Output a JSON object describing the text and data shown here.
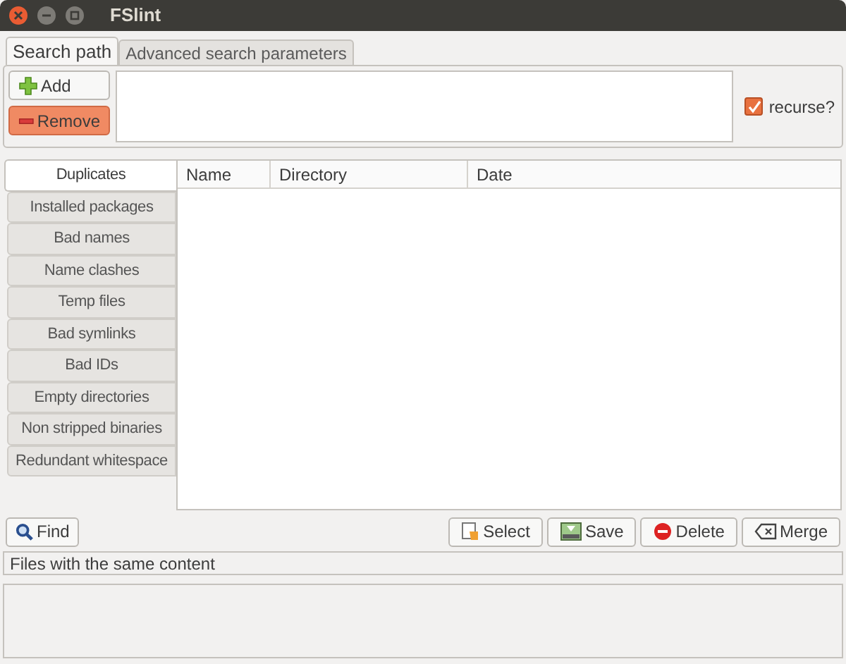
{
  "window": {
    "title": "FSlint"
  },
  "tabs": [
    {
      "label": "Search path",
      "selected": true
    },
    {
      "label": "Advanced search parameters",
      "selected": false
    }
  ],
  "path_buttons": [
    {
      "kind": "add",
      "label": "Add"
    },
    {
      "kind": "remove",
      "label": "Remove"
    }
  ],
  "recurse": {
    "label": "recurse?",
    "checked": true
  },
  "side_tabs": [
    {
      "label": "Duplicates",
      "selected": true
    },
    {
      "label": "Installed packages",
      "selected": false
    },
    {
      "label": "Bad names",
      "selected": false
    },
    {
      "label": "Name clashes",
      "selected": false
    },
    {
      "label": "Temp files",
      "selected": false
    },
    {
      "label": "Bad symlinks",
      "selected": false
    },
    {
      "label": "Bad IDs",
      "selected": false
    },
    {
      "label": "Empty directories",
      "selected": false
    },
    {
      "label": "Non stripped binaries",
      "selected": false
    },
    {
      "label": "Redundant whitespace",
      "selected": false
    }
  ],
  "table": {
    "columns": [
      "Name",
      "Directory",
      "Date"
    ]
  },
  "find_button": "Find",
  "action_buttons": [
    {
      "kind": "select",
      "label": "Select"
    },
    {
      "kind": "save",
      "label": "Save"
    },
    {
      "kind": "delete",
      "label": "Delete"
    },
    {
      "kind": "merge",
      "label": "Merge"
    }
  ],
  "status": "Files with the same content"
}
